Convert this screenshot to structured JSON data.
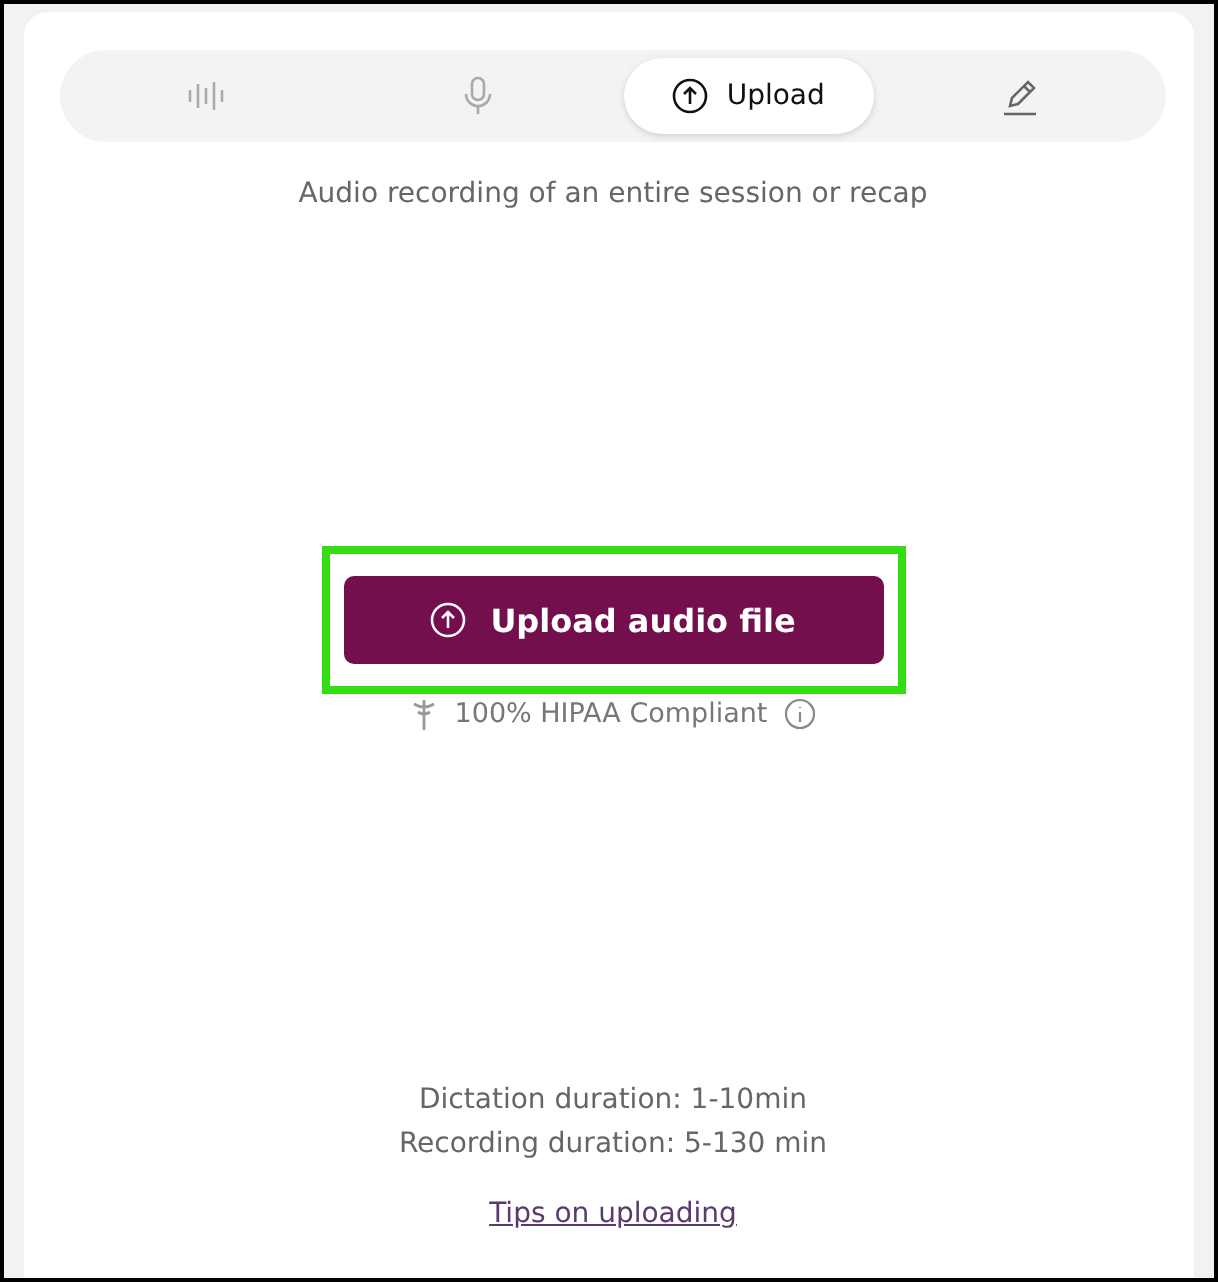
{
  "tabs": [
    {
      "kind": "waveform",
      "selected": false
    },
    {
      "kind": "microphone",
      "selected": false
    },
    {
      "kind": "upload",
      "label": "Upload",
      "selected": true
    },
    {
      "kind": "pencil",
      "selected": false
    }
  ],
  "subtitle": "Audio recording of an entire session or recap",
  "upload_button": {
    "label": "Upload audio file",
    "highlighted": true
  },
  "compliance": {
    "label": "100% HIPAA Compliant"
  },
  "durations": [
    "Dictation duration: 1-10min",
    "Recording duration: 5-130 min"
  ],
  "tips_link": "Tips on uploading"
}
